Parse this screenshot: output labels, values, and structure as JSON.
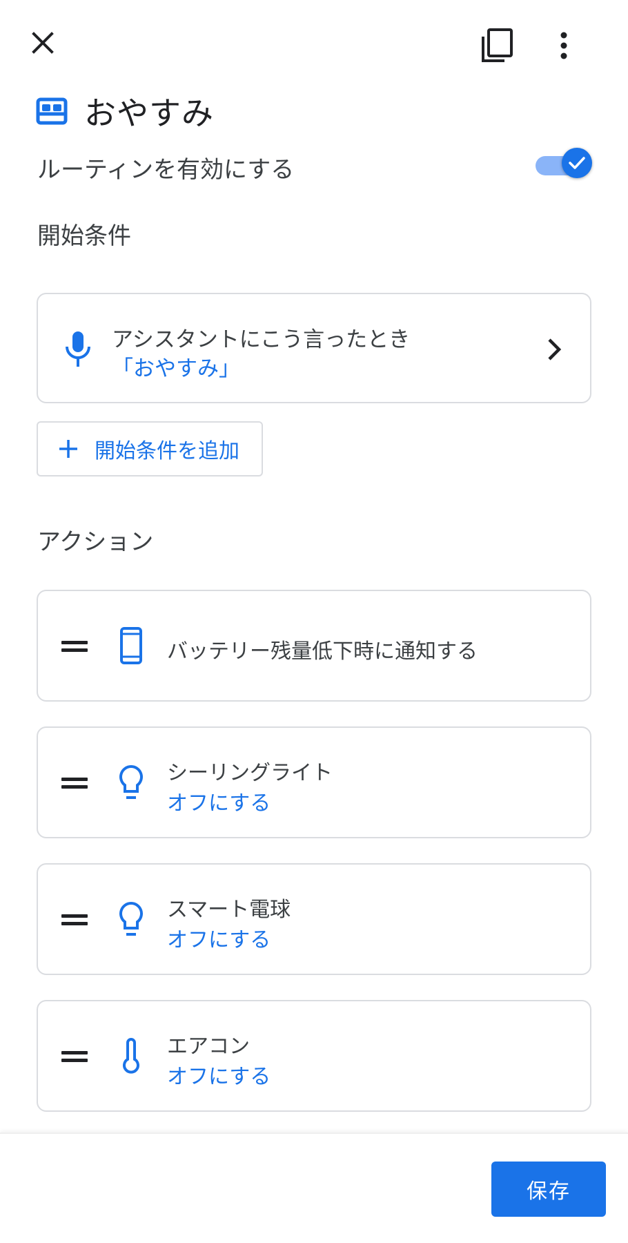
{
  "colors": {
    "accent": "#1a73e8",
    "text": "#202124",
    "border": "#dadce0",
    "toggle_track": "#8ab4f8"
  },
  "topbar": {
    "icons": [
      "close-icon",
      "copy-icon",
      "more-vert-icon"
    ]
  },
  "routine": {
    "icon": "bed-icon",
    "title": "おやすみ",
    "enable_label": "ルーティンを有効にする",
    "enabled": true
  },
  "starters": {
    "section_title": "開始条件",
    "items": [
      {
        "icon": "mic-icon",
        "label": "アシスタントにこう言ったとき",
        "value": "「おやすみ」"
      }
    ],
    "add_label": "開始条件を追加"
  },
  "actions": {
    "section_title": "アクション",
    "items": [
      {
        "icon": "phone-icon",
        "title": "バッテリー残量低下時に通知する",
        "subtitle": ""
      },
      {
        "icon": "lightbulb-icon",
        "title": "シーリングライト",
        "subtitle": "オフにする"
      },
      {
        "icon": "lightbulb-icon",
        "title": "スマート電球",
        "subtitle": "オフにする"
      },
      {
        "icon": "thermometer-icon",
        "title": "エアコン",
        "subtitle": "オフにする"
      }
    ]
  },
  "footer": {
    "save_label": "保存"
  }
}
